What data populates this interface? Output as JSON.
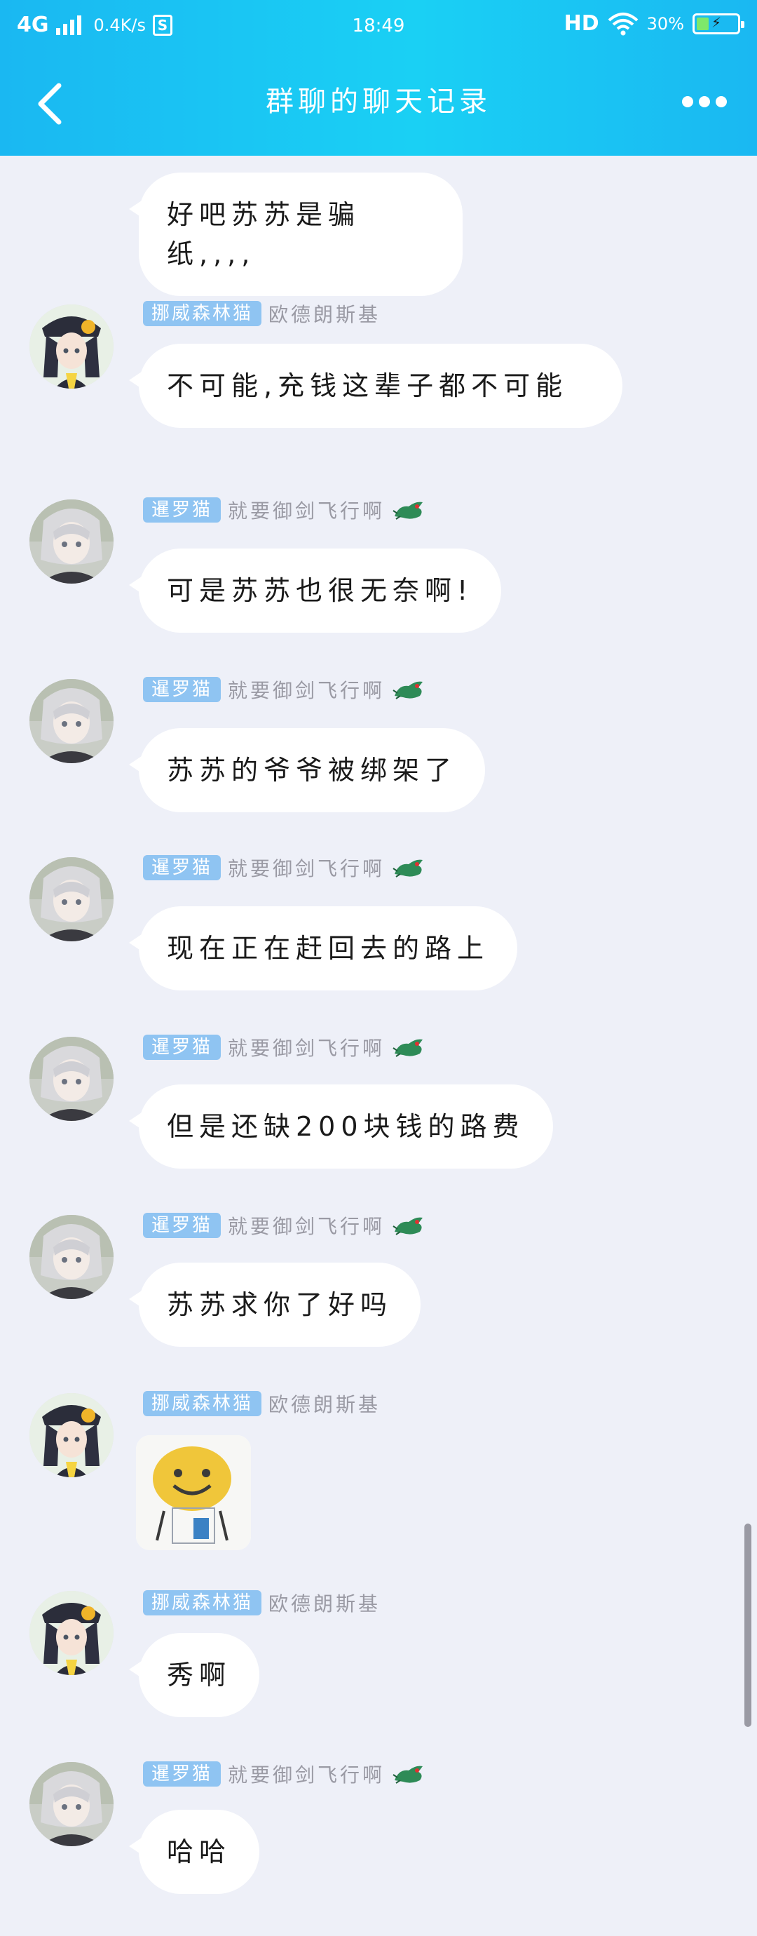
{
  "status_bar": {
    "network": "4G",
    "speed": "0.4K/s",
    "s_badge": "S",
    "time": "18:49",
    "hd": "HD",
    "battery_percent": "30%",
    "battery_level": 0.3,
    "battery_bolt": "⚡"
  },
  "nav": {
    "title": "群聊的聊天记录",
    "back_icon": "chevron-left-icon",
    "more_icon": "more-dots-icon"
  },
  "messages": [
    {
      "badge": "",
      "nickname": "",
      "text": "好吧苏苏是骗纸,,,,",
      "sender": "cat"
    },
    {
      "badge": "挪威森林猫",
      "nickname": "欧德朗斯基",
      "text": "不可能,充钱这辈子都不可能",
      "sender": "girl"
    },
    {
      "badge": "暹罗猫",
      "nickname": "就要御剑飞行啊",
      "text": "可是苏苏也很无奈啊!",
      "sender": "cat"
    },
    {
      "badge": "暹罗猫",
      "nickname": "就要御剑飞行啊",
      "text": "苏苏的爷爷被绑架了",
      "sender": "cat"
    },
    {
      "badge": "暹罗猫",
      "nickname": "就要御剑飞行啊",
      "text": "现在正在赶回去的路上",
      "sender": "cat"
    },
    {
      "badge": "暹罗猫",
      "nickname": "就要御剑飞行啊",
      "text": "但是还缺200块钱的路费",
      "sender": "cat"
    },
    {
      "badge": "暹罗猫",
      "nickname": "就要御剑飞行啊",
      "text": "苏苏求你了好吗",
      "sender": "cat"
    },
    {
      "badge": "挪威森林猫",
      "nickname": "欧德朗斯基",
      "text": "",
      "sticker": "smiley-sticker",
      "sender": "girl"
    },
    {
      "badge": "挪威森林猫",
      "nickname": "欧德朗斯基",
      "text": "秀啊",
      "sender": "girl"
    },
    {
      "badge": "暹罗猫",
      "nickname": "就要御剑飞行啊",
      "text": "哈哈",
      "sender": "cat"
    }
  ],
  "colors": {
    "header_gradient_start": "#1ab8f2",
    "header_gradient_mid": "#1ad0f4",
    "background": "#eef0f8",
    "badge": "#8fc4f2",
    "nickname": "#9a9aa4",
    "bubble": "#ffffff"
  }
}
